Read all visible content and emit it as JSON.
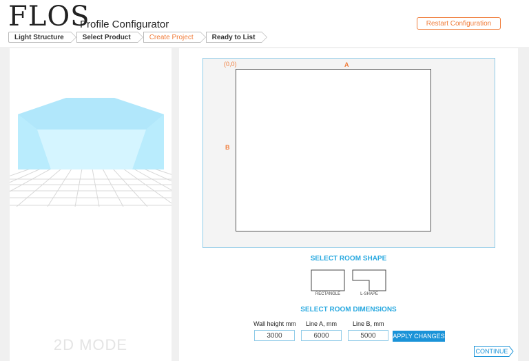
{
  "header": {
    "logo": "FLOS",
    "title": "Profile Configurator",
    "restart_label": "Restart Configuration"
  },
  "steps": [
    {
      "label": "Light Structure",
      "active": false
    },
    {
      "label": "Select Product",
      "active": false
    },
    {
      "label": "Create Project",
      "active": true
    },
    {
      "label": "Ready to List",
      "active": false
    }
  ],
  "preview": {
    "mode_label": "2D MODE"
  },
  "canvas": {
    "origin_label": "(0,0)",
    "dim_a_label": "A",
    "dim_b_label": "B"
  },
  "room_shape": {
    "title": "SELECT ROOM SHAPE",
    "options": [
      {
        "icon": "rectangle-shape-icon",
        "label": "RECTANGLE"
      },
      {
        "icon": "l-shape-icon",
        "label": "L-SHAPE"
      }
    ]
  },
  "dimensions": {
    "title": "SELECT ROOM DIMENSIONS",
    "fields": [
      {
        "label": "Wall height mm",
        "value": "3000"
      },
      {
        "label": "Line A, mm",
        "value": "6000"
      },
      {
        "label": "Line B, mm",
        "value": "5000"
      }
    ],
    "apply_label": "APPLY CHANGES"
  },
  "continue_label": "CONTINUE",
  "colors": {
    "accent_orange": "#f07c3a",
    "accent_blue": "#29a9e0",
    "button_blue": "#1a93d8",
    "preview_cyan": "#bfefff"
  }
}
